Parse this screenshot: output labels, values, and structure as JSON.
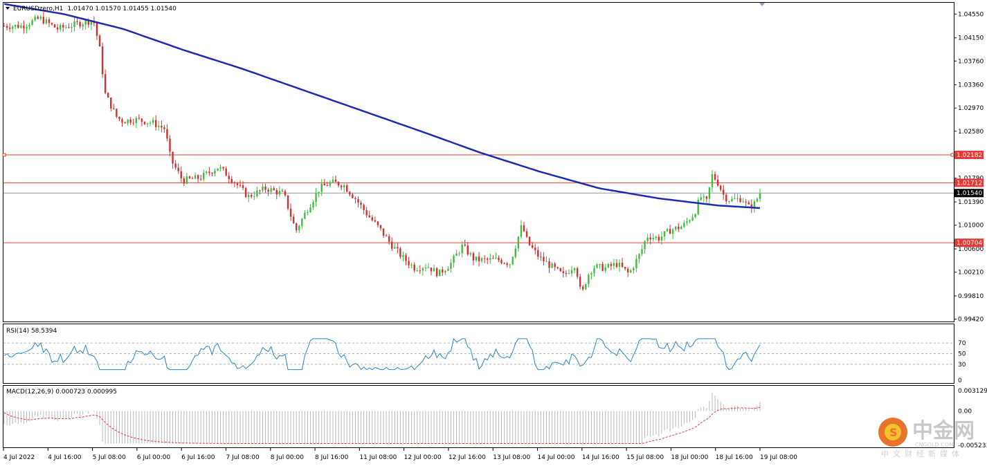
{
  "header": {
    "symbol": "EURUSDzero,H1",
    "ohlc": "1.01470 1.01570 1.01455 1.01540"
  },
  "main_price_axis": [
    "1.04550",
    "1.04150",
    "1.03760",
    "1.03360",
    "1.02970",
    "1.02580",
    "1.02180",
    "1.01790",
    "1.01390",
    "1.01000",
    "1.00600",
    "1.00210",
    "0.99810",
    "0.99420"
  ],
  "level_tags": [
    {
      "label": "1.02182",
      "value": 1.02182,
      "color": "#e53935"
    },
    {
      "label": "1.01712",
      "value": 1.01712,
      "color": "#e53935"
    },
    {
      "label": "1.01540",
      "value": 1.0154,
      "color": "#000000"
    },
    {
      "label": "1.00704",
      "value": 1.00704,
      "color": "#e53935"
    }
  ],
  "rsi": {
    "label": "RSI(14) 58.5394",
    "axis": [
      "70",
      "50",
      "30",
      "0"
    ],
    "levels": [
      70,
      50,
      30
    ]
  },
  "macd": {
    "label": "MACD(12,26,9) 0.000723 0.000995",
    "axis": [
      "0.003129",
      "0.00",
      "-0.005233"
    ]
  },
  "time_axis": [
    "4 Jul 2022",
    "4 Jul 16:00",
    "5 Jul 08:00",
    "6 Jul 00:00",
    "6 Jul 16:00",
    "7 Jul 08:00",
    "8 Jul 00:00",
    "8 Jul 16:00",
    "11 Jul 08:00",
    "12 Jul 00:00",
    "12 Jul 16:00",
    "13 Jul 08:00",
    "14 Jul 00:00",
    "14 Jul 16:00",
    "15 Jul 08:00",
    "18 Jul 00:00",
    "18 Jul 16:00",
    "19 Jul 08:00"
  ],
  "watermark": {
    "brand": "中金网",
    "domain": "CNGOLD.COM",
    "tagline": "中文财经新媒体"
  },
  "colors": {
    "bull": "#3cbf3c",
    "bear": "#d32f2f",
    "ma": "#1a2bb0",
    "rsi": "#2a84c4",
    "macd_signal": "#e53935",
    "macd_hist": "#b8b8b8"
  },
  "chart_data": {
    "type": "candlestick",
    "symbol": "EURUSDzero",
    "timeframe": "H1",
    "y_range": [
      0.9938,
      1.0474
    ],
    "moving_average": {
      "points": [
        [
          0,
          1.0472
        ],
        [
          0.1,
          1.0455
        ],
        [
          0.2,
          1.043
        ],
        [
          0.3,
          1.0395
        ],
        [
          0.4,
          1.0363
        ],
        [
          0.5,
          1.0328
        ],
        [
          0.6,
          1.0293
        ],
        [
          0.7,
          1.0258
        ],
        [
          0.8,
          1.0222
        ],
        [
          0.9,
          1.019
        ],
        [
          1.0,
          1.0162
        ],
        [
          1.1,
          1.0145
        ],
        [
          1.2,
          1.0133
        ],
        [
          1.3,
          1.0127
        ]
      ]
    },
    "price_path": [
      [
        0,
        1.0435
      ],
      [
        0.03,
        1.0435
      ],
      [
        0.06,
        1.0448
      ],
      [
        0.09,
        1.043
      ],
      [
        0.12,
        1.0438
      ],
      [
        0.15,
        1.0445
      ],
      [
        0.16,
        1.04
      ],
      [
        0.17,
        1.032
      ],
      [
        0.18,
        1.03
      ],
      [
        0.19,
        1.028
      ],
      [
        0.2,
        1.0275
      ],
      [
        0.22,
        1.0278
      ],
      [
        0.25,
        1.0272
      ],
      [
        0.27,
        1.0262
      ],
      [
        0.28,
        1.021
      ],
      [
        0.3,
        1.0175
      ],
      [
        0.33,
        1.018
      ],
      [
        0.36,
        1.0198
      ],
      [
        0.38,
        1.018
      ],
      [
        0.41,
        1.0148
      ],
      [
        0.44,
        1.0162
      ],
      [
        0.47,
        1.0152
      ],
      [
        0.49,
        1.009
      ],
      [
        0.51,
        1.0128
      ],
      [
        0.53,
        1.0162
      ],
      [
        0.55,
        1.0172
      ],
      [
        0.57,
        1.0168
      ],
      [
        0.59,
        1.0145
      ],
      [
        0.61,
        1.0118
      ],
      [
        0.63,
        1.0095
      ],
      [
        0.65,
        1.0068
      ],
      [
        0.67,
        1.0045
      ],
      [
        0.69,
        1.0028
      ],
      [
        0.71,
        1.0032
      ],
      [
        0.73,
        1.0018
      ],
      [
        0.75,
        1.0035
      ],
      [
        0.77,
        1.0065
      ],
      [
        0.79,
        1.0042
      ],
      [
        0.81,
        1.0041
      ],
      [
        0.83,
        1.0042
      ],
      [
        0.85,
        1.0036
      ],
      [
        0.87,
        1.01
      ],
      [
        0.88,
        1.007
      ],
      [
        0.9,
        1.0045
      ],
      [
        0.92,
        1.003
      ],
      [
        0.94,
        1.0015
      ],
      [
        0.96,
        1.0035
      ],
      [
        0.97,
        0.998
      ],
      [
        0.98,
        1.0015
      ],
      [
        0.99,
        1.003
      ],
      [
        1.01,
        1.0028
      ],
      [
        1.03,
        1.0035
      ],
      [
        1.05,
        1.0018
      ],
      [
        1.07,
        1.0055
      ],
      [
        1.08,
        1.0082
      ],
      [
        1.1,
        1.0078
      ],
      [
        1.12,
        1.0092
      ],
      [
        1.14,
        1.0098
      ],
      [
        1.16,
        1.012
      ],
      [
        1.17,
        1.0148
      ],
      [
        1.18,
        1.0138
      ],
      [
        1.19,
        1.0185
      ],
      [
        1.2,
        1.017
      ],
      [
        1.21,
        1.0148
      ],
      [
        1.22,
        1.0142
      ],
      [
        1.24,
        1.0145
      ],
      [
        1.25,
        1.013
      ],
      [
        1.26,
        1.0135
      ],
      [
        1.27,
        1.0154
      ]
    ],
    "annotations": [
      "1.02182",
      "1.01712",
      "1.01540",
      "1.00704"
    ]
  }
}
